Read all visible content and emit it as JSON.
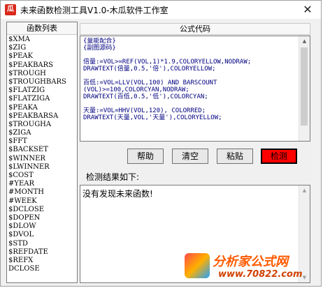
{
  "window": {
    "icon_text": "瓜",
    "title": "未来函数检测工具V1.0-木瓜软件工作室",
    "close_symbol": "✕"
  },
  "function_list": {
    "header": "函数列表",
    "items": [
      "$XMA",
      "$ZIG",
      "$PEAK",
      "$PEAKBARS",
      "$TROUGH",
      "$TROUGHBARS",
      "$FLATZIG",
      "$FLATZIGA",
      "$PEAKA",
      "$PEAKBARSA",
      "$TROUGHA",
      "$ZIGA",
      "$FFT",
      "$BACKSET",
      "$WINNER",
      "$LWINNER",
      "$COST",
      "#YEAR",
      "#MONTH",
      "#WEEK",
      "$DCLOSE",
      "$DOPEN",
      "$DLOW",
      "$DVOL",
      "$STD",
      "$REFDATE",
      "$REFX",
      "DCLOSE"
    ]
  },
  "formula": {
    "header": "公式代码",
    "code": "{量能配合}\n{副图源码}\n\n倍量:=VOL>=REF(VOL,1)*1.9,COLORYELLOW,NODRAW;\nDRAWTEXT(倍量,0.5,'倍'),COLORYELLOW;\n\n百低:=VOL=LLV(VOL,100) AND BARSCOUNT\n(VOL)>=100,COLORCYAN,NODRAW;\nDRAWTEXT(百低,0.5,'低'),COLORCYAN;\n\n天量:=VOL=HHV(VOL,120), COLORRED;\nDRAWTEXT(天量,VOL,'天量'),COLORYELLOW;",
    "scroll_up": "▲",
    "scroll_down": "▼"
  },
  "buttons": {
    "help": "帮助",
    "clear": "清空",
    "paste": "粘贴",
    "detect": "检测"
  },
  "result": {
    "label": "检测结果如下:",
    "text": "没有发现未来函数!",
    "scroll_up": "▲",
    "scroll_down": "▼"
  },
  "watermark": {
    "brand": "分析家公式网",
    "url": "www.70822.com"
  },
  "colors": {
    "detect_button": "#ff0000",
    "code_text": "#000080",
    "watermark": "#ff5a00"
  }
}
